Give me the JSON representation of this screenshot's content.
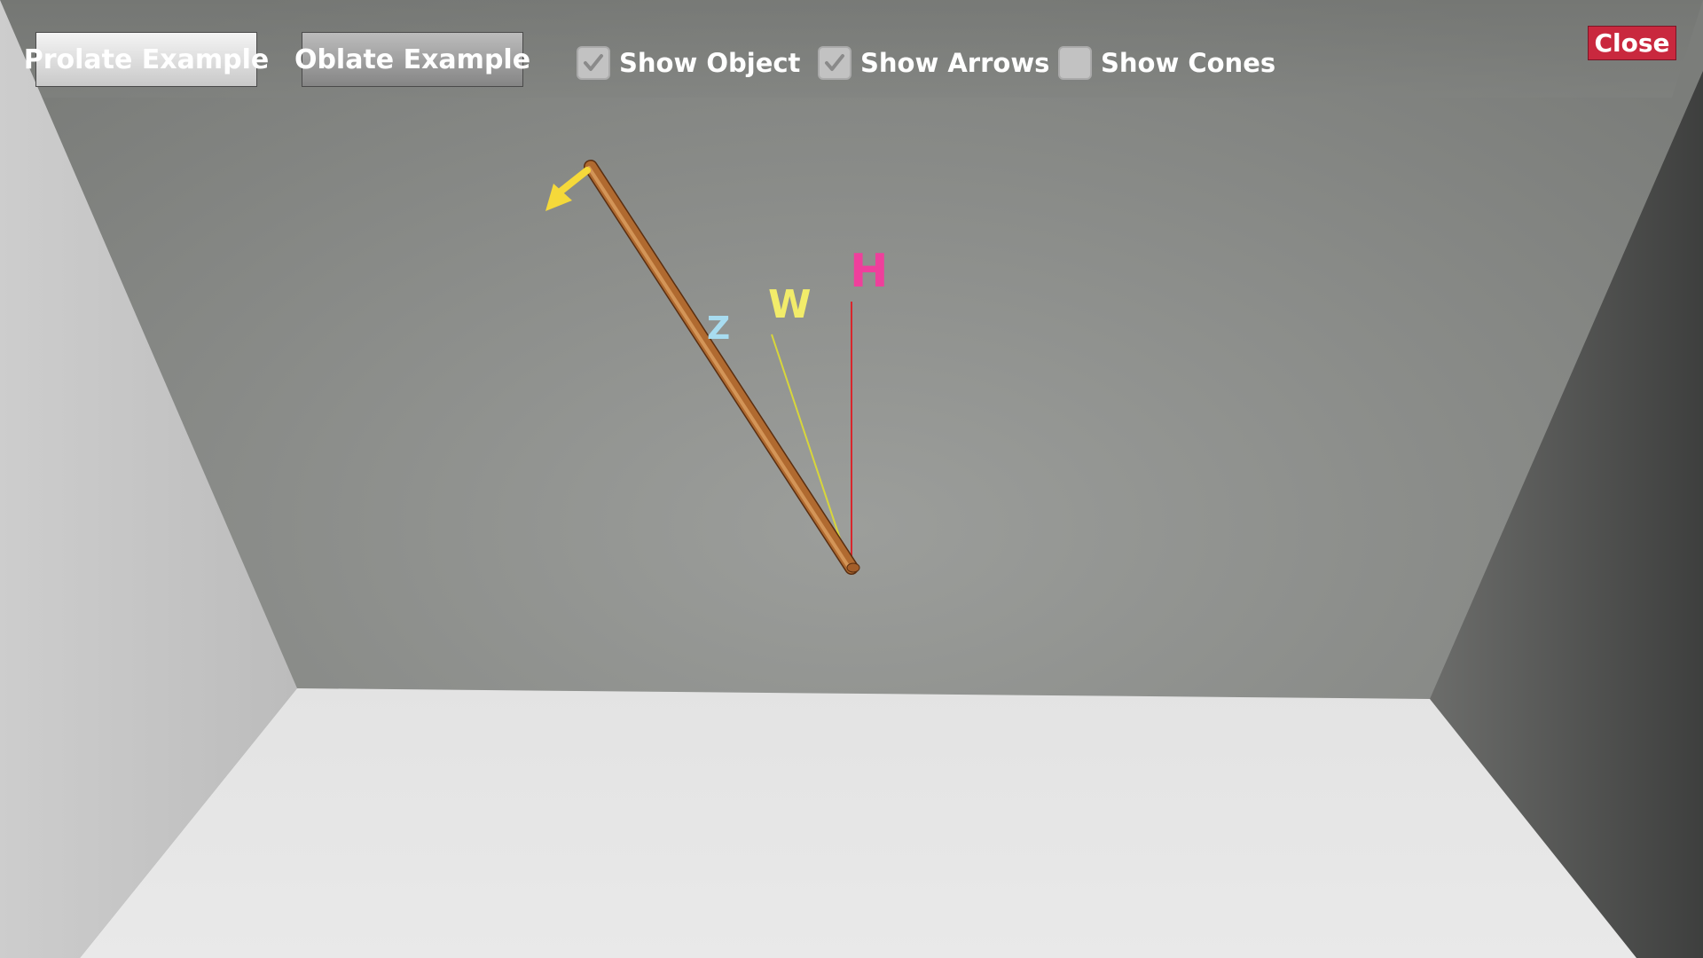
{
  "toolbar": {
    "prolate_label": "Prolate Example",
    "oblate_label": "Oblate Example",
    "show_object": {
      "label": "Show Object",
      "checked": true
    },
    "show_arrows": {
      "label": "Show Arrows",
      "checked": true
    },
    "show_cones": {
      "label": "Show Cones",
      "checked": false
    },
    "close_label": "Close"
  },
  "scene": {
    "axis_labels": {
      "z": "Z",
      "w": "W",
      "h": "H"
    },
    "colors": {
      "z_label": "#a8dcf0",
      "w_label": "#f2ec6a",
      "h_label": "#ef3f9c",
      "w_line": "#d8d63a",
      "h_line": "#d9262c",
      "rod": "#b06a30",
      "arrow": "#f5d93a",
      "close_button": "#c9283e"
    }
  }
}
